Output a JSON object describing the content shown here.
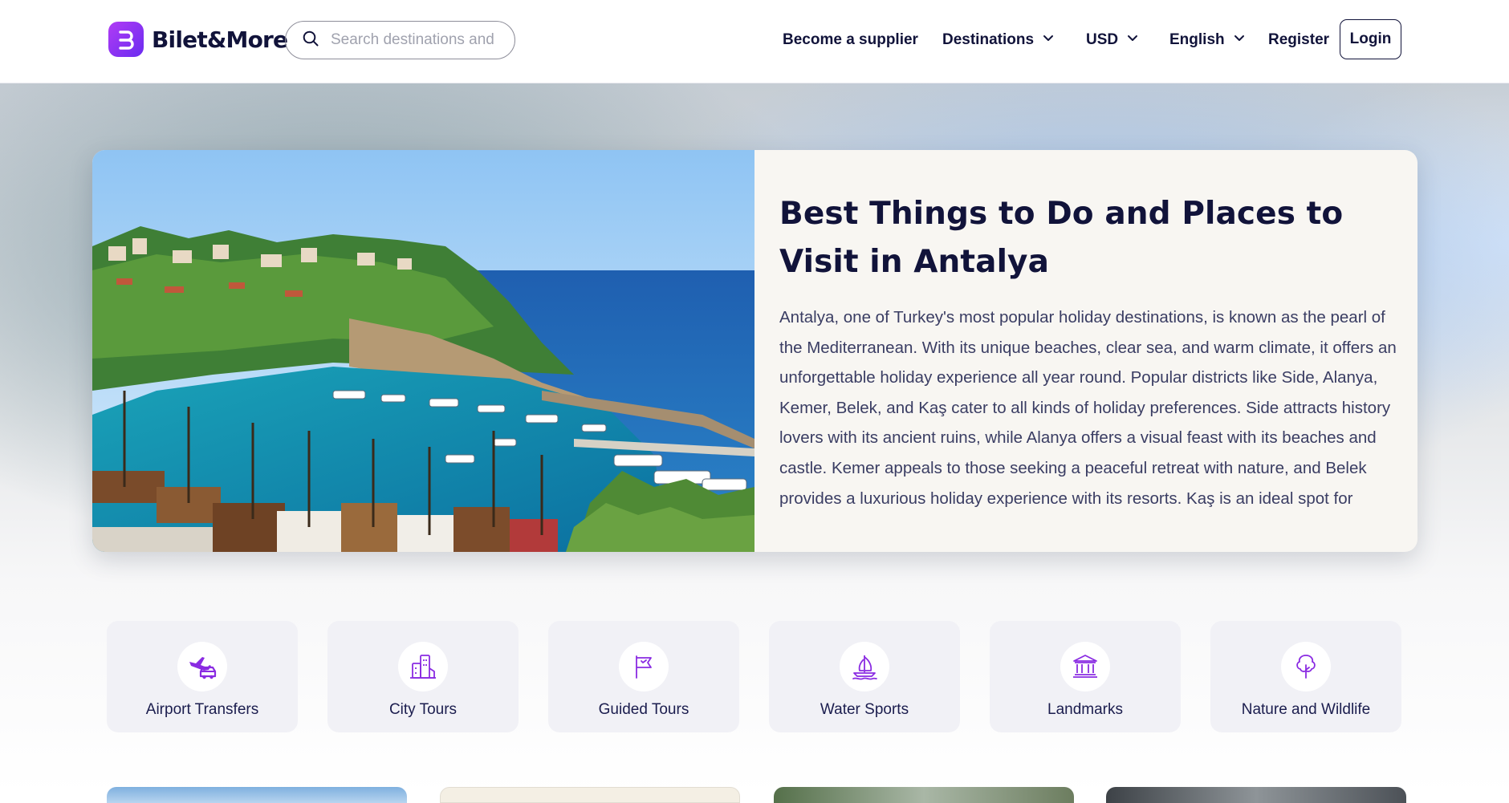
{
  "header": {
    "logo_text": "Bilet&More",
    "search_placeholder": "Search destinations and",
    "nav": {
      "supplier": "Become a supplier",
      "destinations": "Destinations",
      "currency": "USD",
      "language": "English",
      "register": "Register",
      "login": "Login"
    }
  },
  "hero": {
    "title": "Best Things to Do and Places to Visit in Antalya",
    "description": "Antalya, one of Turkey's most popular holiday destinations, is known as the pearl of the Mediterranean. With its unique beaches, clear sea, and warm climate, it offers an unforgettable holiday experience all year round. Popular districts like Side, Alanya, Kemer, Belek, and Kaş cater to all kinds of holiday preferences. Side attracts history lovers with its ancient ruins, while Alanya offers a visual feast with its beaches and castle. Kemer appeals to those seeking a peaceful retreat with nature, and Belek provides a luxurious holiday experience with its resorts. Kaş is an ideal spot for those who enjoy tranquility and diving."
  },
  "categories": [
    {
      "label": "Airport Transfers",
      "icon": "airport-transfer-icon"
    },
    {
      "label": "City Tours",
      "icon": "city-buildings-icon"
    },
    {
      "label": "Guided Tours",
      "icon": "flag-icon"
    },
    {
      "label": "Water Sports",
      "icon": "sailboat-icon"
    },
    {
      "label": "Landmarks",
      "icon": "landmark-icon"
    },
    {
      "label": "Nature and Wildlife",
      "icon": "tree-icon"
    }
  ],
  "colors": {
    "accent": "#8a2be2",
    "text_dark": "#11133a",
    "category_bg": "#f1f1f6"
  }
}
